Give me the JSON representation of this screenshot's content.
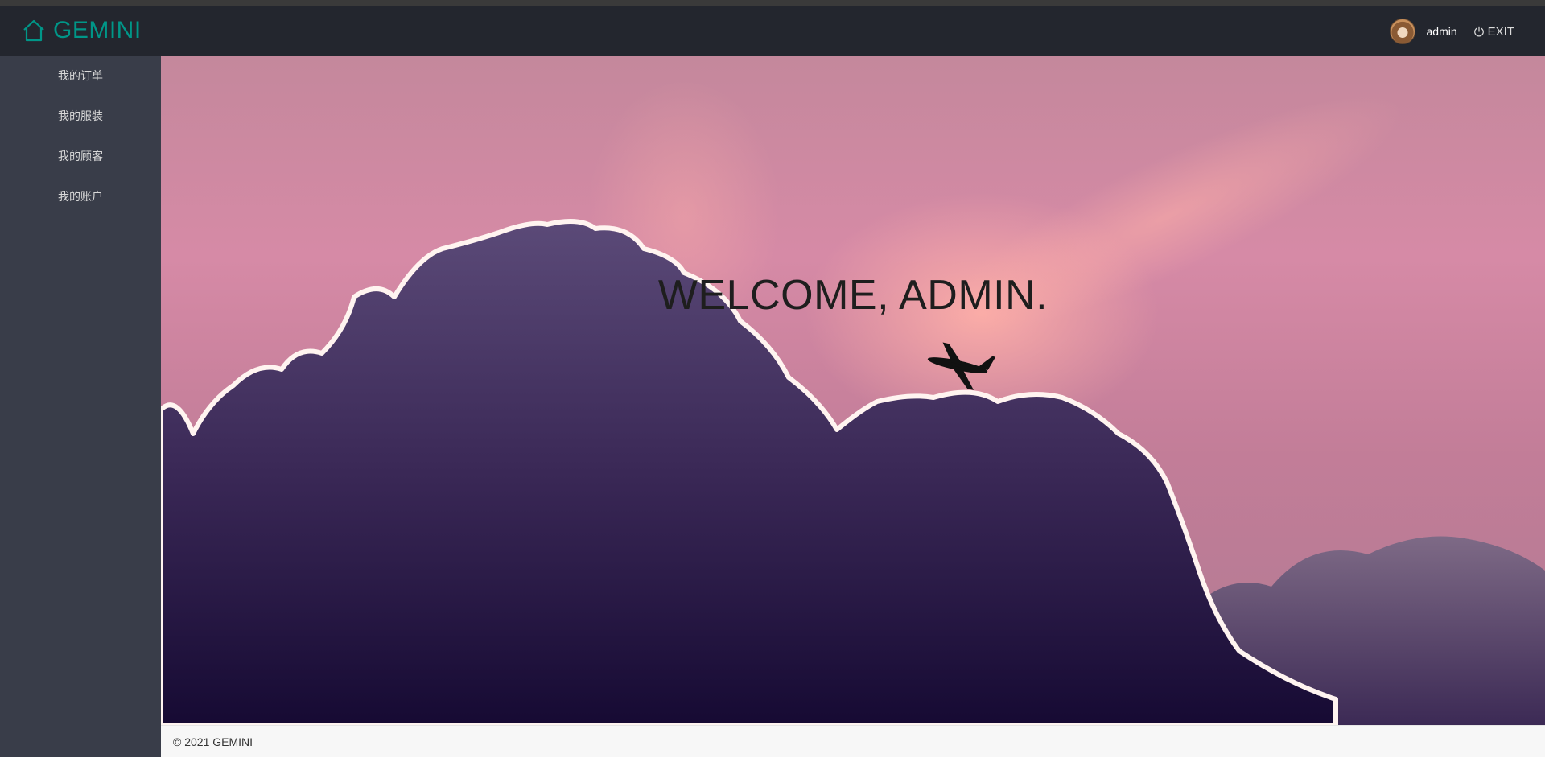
{
  "header": {
    "brand": "GEMINI",
    "username": "admin",
    "exit_label": "EXIT",
    "brand_color": "#009688",
    "header_bg": "#23262e"
  },
  "sidebar": {
    "bg": "#393d49",
    "items": [
      {
        "label": "我的订单"
      },
      {
        "label": "我的服装"
      },
      {
        "label": "我的顾客"
      },
      {
        "label": "我的账户"
      }
    ]
  },
  "main": {
    "welcome": "WELCOME, ADMIN."
  },
  "footer": {
    "text": "© 2021 GEMINI"
  },
  "icons": {
    "logo": "home-icon",
    "exit": "power-icon",
    "avatar": "user-avatar"
  }
}
